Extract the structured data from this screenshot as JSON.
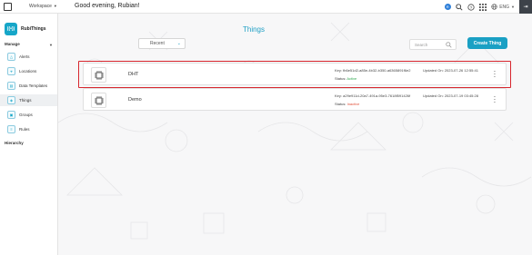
{
  "topbar": {
    "workspace_label": "Workspace",
    "greeting": "Good evening, Rubian!",
    "user_initial": "R",
    "language": "ENG"
  },
  "sidebar": {
    "brand": "RubiThings",
    "manage_title": "Manage",
    "hierarchy_title": "Hierarchy",
    "items": [
      {
        "label": "Alerts"
      },
      {
        "label": "Locations"
      },
      {
        "label": "Data Templates"
      },
      {
        "label": "Things"
      },
      {
        "label": "Groups"
      },
      {
        "label": "Rules"
      }
    ]
  },
  "main": {
    "title": "Things",
    "filter_value": "Recent",
    "search_placeholder": "Search",
    "create_button": "Create Thing",
    "key_label": "Key:",
    "status_label": "Status:",
    "updated_label": "Updated On:",
    "things": [
      {
        "name": "DHT",
        "key": "fb6e51d2-a85e-4b32-b350-a6365891f6e2",
        "status": "Active",
        "updated": "2023-07-26 12:55:41"
      },
      {
        "name": "Demo",
        "key": "a29e911d-20a7-491a-95e3-7618f591426f",
        "status": "Inactive",
        "updated": "2023-07-19 03:45:28"
      }
    ]
  },
  "colors": {
    "accent": "#1aa0c4",
    "active": "#2fa84f",
    "inactive": "#e2533b",
    "highlight": "#d7262e"
  }
}
